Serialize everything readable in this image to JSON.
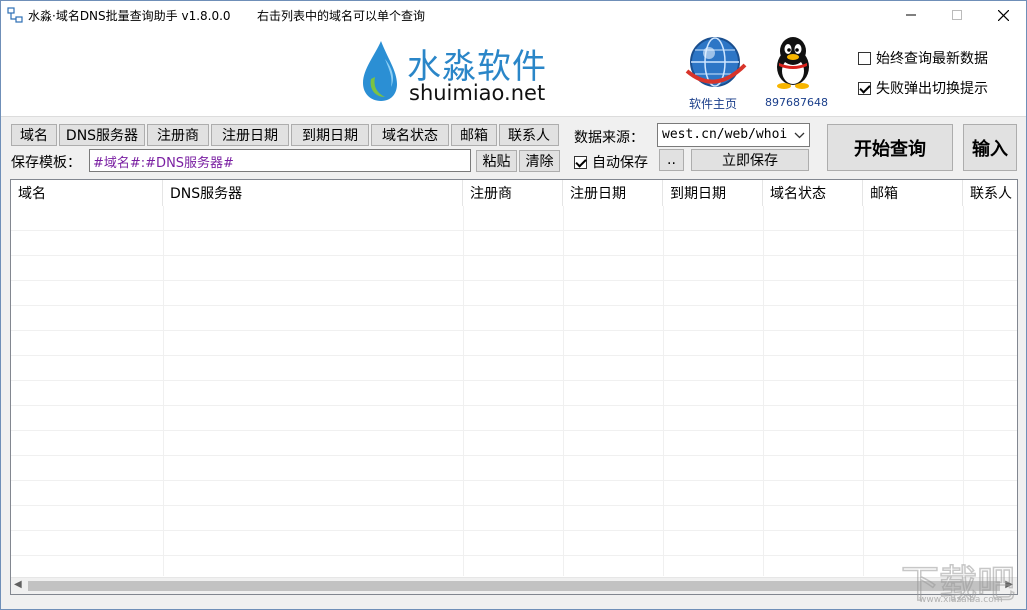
{
  "titlebar": {
    "title": "水淼·域名DNS批量查询助手 v1.8.0.0",
    "hint": "右击列表中的域名可以单个查询"
  },
  "header": {
    "logo_cn": "水淼软件",
    "logo_en": "shuimiao.net",
    "homepage_label": "软件主页",
    "qq_label": "897687648",
    "check_latest": {
      "label": "始终查询最新数据",
      "checked": false
    },
    "check_fail_prompt": {
      "label": "失败弹出切换提示",
      "checked": true
    }
  },
  "toolbar": {
    "field_buttons": [
      "域名",
      "DNS服务器",
      "注册商",
      "注册日期",
      "到期日期",
      "域名状态",
      "邮箱",
      "联系人"
    ],
    "template_label": "保存模板：",
    "template_value": "#域名#:#DNS服务器#",
    "paste_label": "粘贴",
    "clear_label": "清除",
    "source_label": "数据来源：",
    "source_value": "west.cn/web/whoi",
    "auto_save": {
      "label": "自动保存",
      "checked": true
    },
    "browse_label": "..",
    "save_now_label": "立即保存",
    "start_label": "开始查询",
    "input_label": "输入"
  },
  "table": {
    "columns": [
      "域名",
      "DNS服务器",
      "注册商",
      "注册日期",
      "到期日期",
      "域名状态",
      "邮箱",
      "联系人"
    ],
    "rows": []
  },
  "watermark": {
    "text": "www.xiazaiba.com"
  }
}
